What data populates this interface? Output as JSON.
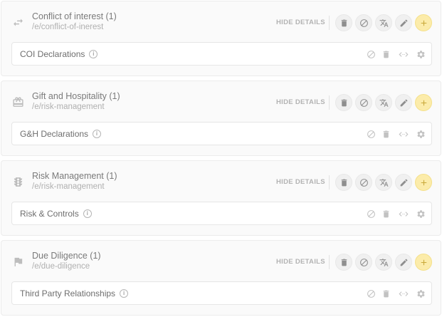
{
  "hide_details_label": "HIDE DETAILS",
  "colors": {
    "add_button": "#fcecaa",
    "icon_grey": "#bdbdbd"
  },
  "panels": [
    {
      "icon": "swap-arrows-icon",
      "title": "Conflict of interest (1)",
      "path": "/e/conflict-of-inerest",
      "item": "COI Declarations"
    },
    {
      "icon": "gift-icon",
      "title": "Gift and Hospitality (1)",
      "path": "/e/risk-management",
      "item": "G&H Declarations"
    },
    {
      "icon": "traffic-light-icon",
      "title": "Risk Management (1)",
      "path": "/e/risk-management",
      "item": "Risk & Controls"
    },
    {
      "icon": "flag-icon",
      "title": "Due Diligence (1)",
      "path": "/e/due-diligence",
      "item": "Third Party Relationships"
    }
  ]
}
